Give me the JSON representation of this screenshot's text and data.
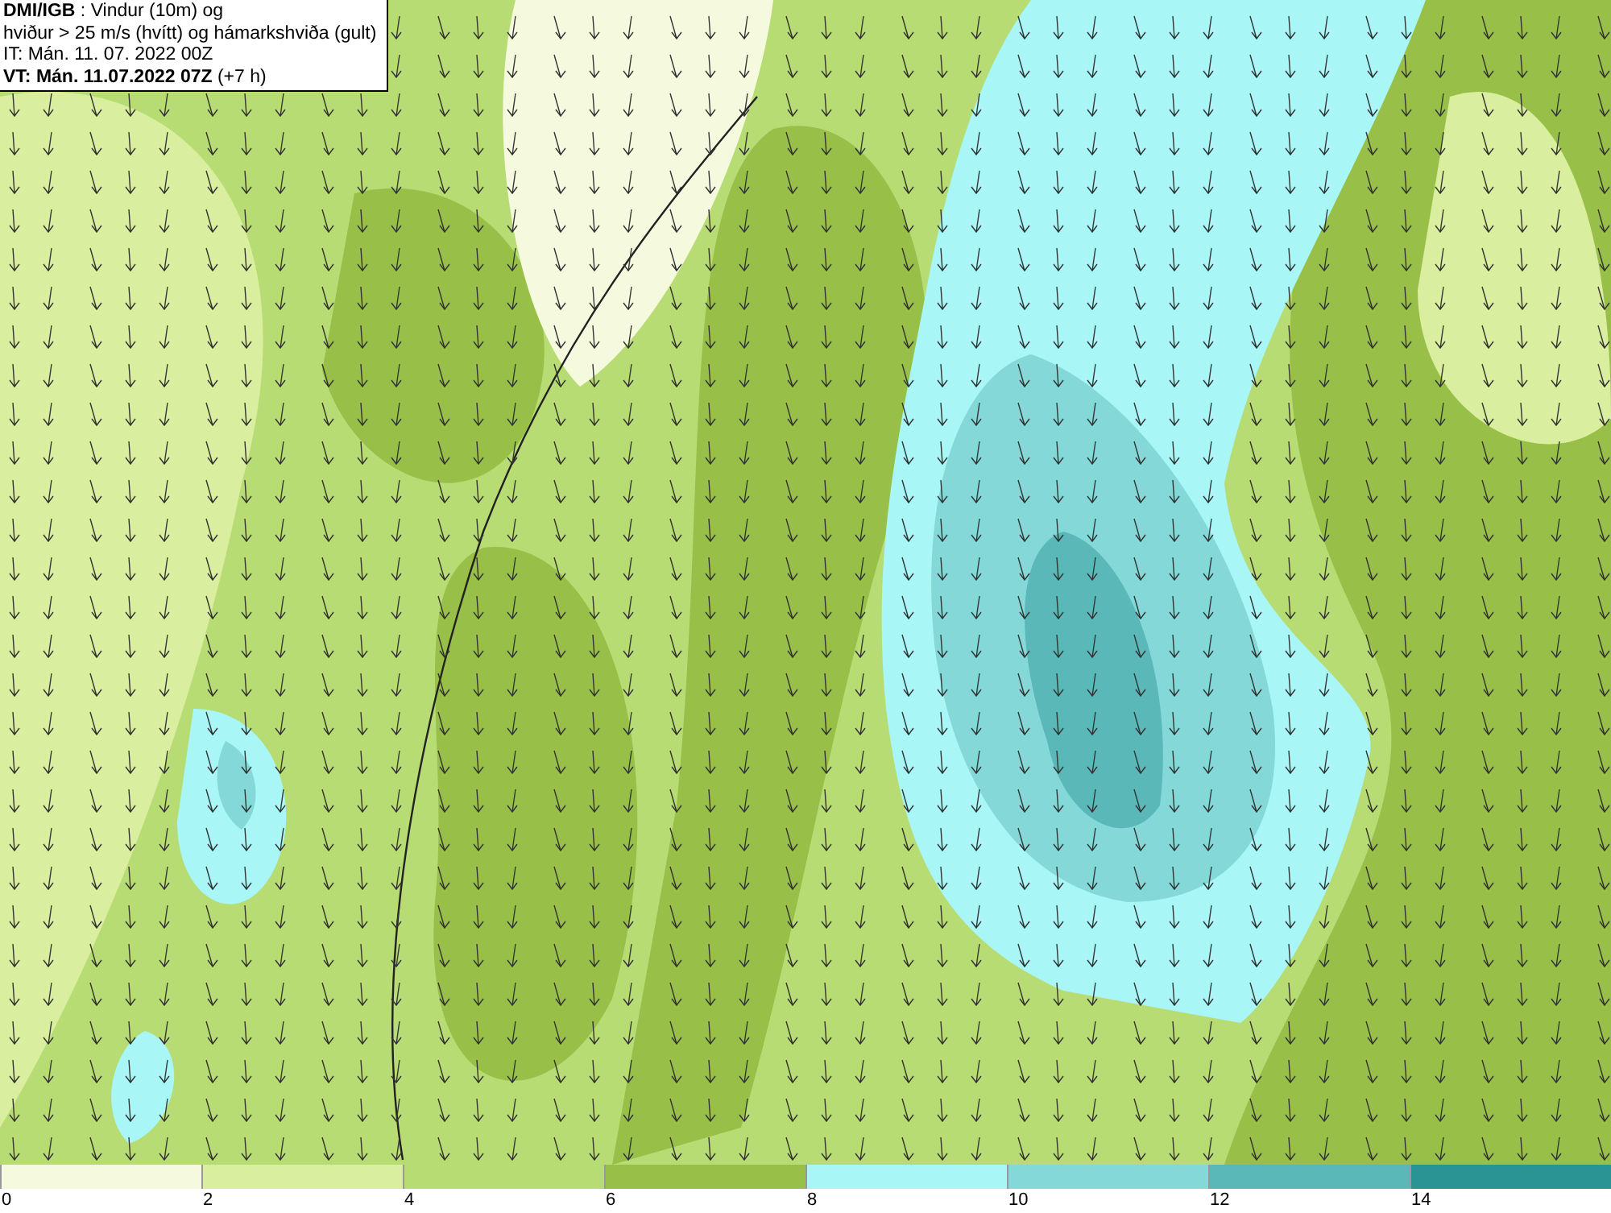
{
  "title_box": {
    "lines": [
      "**DMI/IGB** : Vindur (10m) og",
      "hviður > 25 m/s (hvítt) og hámarkshviða (gult)",
      "IT: Mán. 11. 07. 2022 00Z",
      "**VT: Mán. 11.07.2022 07Z** (+7 h)"
    ]
  },
  "legend": [
    {
      "label": "0",
      "color": "#f5fadf"
    },
    {
      "label": "2",
      "color": "#d9ee9e"
    },
    {
      "label": "4",
      "color": "#b8dc74"
    },
    {
      "label": "6",
      "color": "#98c048"
    },
    {
      "label": "8",
      "color": "#a8f6f6"
    },
    {
      "label": "10",
      "color": "#84d8d8"
    },
    {
      "label": "12",
      "color": "#5ab8b8"
    },
    {
      "label": "14",
      "color": "#2a9494"
    }
  ]
}
